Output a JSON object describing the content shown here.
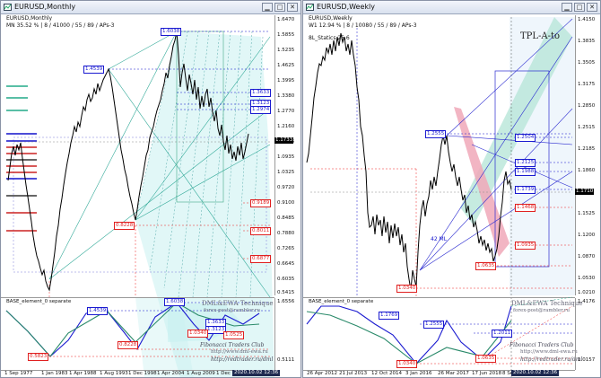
{
  "left": {
    "title": "EURUSD,Monthly",
    "info_line": "MN  35.52 %  | 8 / 41000 / 55 / 89 / APs-3",
    "sub_info": "EURUSD,Monthly",
    "subwindow_label": "BASE_element_0 separate",
    "current_price": "1.1733",
    "price_scale": [
      "1.6470",
      "1.5855",
      "1.5235",
      "1.4625",
      "1.3995",
      "1.3380",
      "1.2770",
      "1.2160",
      "1.1545",
      "1.0935",
      "1.0325",
      "0.9720",
      "0.9100",
      "0.8485",
      "0.7880",
      "0.7265",
      "0.6645",
      "0.6035",
      "0.5415"
    ],
    "sub_scale": [
      "1.6556",
      "0.5111"
    ],
    "time_scale": [
      "1 Sep 1977",
      "1 Jan 1983",
      "1 Apr 1988",
      "1 Aug 1993",
      "1 Dec 1998",
      "1 Apr 2004",
      "1 Aug 2009",
      "1 Dec"
    ],
    "time_badge": "2020.10.02 12:36",
    "levels": {
      "l1": "1.6038",
      "l2": "1.4539",
      "l3": "1.3633",
      "l4": "1.3123",
      "l5": "1.2974",
      "l6": "0.9189",
      "l7": "0.8228",
      "l8": "0.8011",
      "l9": "0.6877"
    },
    "sub_levels": {
      "s1": "1.6038",
      "s2": "1.4539",
      "s3": "0.8228",
      "s4": "1.3633",
      "s5": "1.3123",
      "s6": "1.0340",
      "s7": "1.0525",
      "s8": "0.5823"
    },
    "watermark": {
      "l1": "DML&EWA Technique",
      "l2": "forex-post@rambler.ru",
      "l3": "Fibonacci Traders Club",
      "l4": "http://www.dml-ewa.ru",
      "l5": "http://redtrader.ru/dml"
    }
  },
  "right": {
    "title": "EURUSD,Weekly",
    "info_line": "W1  12.94 %  | 8 / 10080 / 55 / 89 / APs-3",
    "sub_info": "EURUSD,Weekly",
    "indicator_label": "8L_Statics 25.6",
    "tpl_label": "TPL-A-to",
    "ml_label": "42 ML",
    "current_price": "1.1710",
    "price_scale": [
      "1.4150",
      "1.3835",
      "1.3505",
      "1.3175",
      "1.2850",
      "1.2515",
      "1.2185",
      "1.1860",
      "1.1525",
      "1.1200",
      "1.0870",
      "1.0530",
      "1.0210"
    ],
    "sub_scale": [
      "1.4176",
      "1.0157"
    ],
    "time_scale": [
      "26 Apr 2012",
      "21 Jul 2013",
      "12 Oct 2014",
      "3 Jan 2016",
      "26 Mar 2017",
      "17 Jun 2018",
      "8 Se"
    ],
    "time_badge": "2020.10.02 12:36",
    "subwindow_label": "BASE_element_0 separate",
    "levels": {
      "l1": "1.2555",
      "l2": "1.2504",
      "l3": "1.2125",
      "l4": "1.1988",
      "l5": "1.1739",
      "l6": "1.1468",
      "l7": "1.0935",
      "l8": "1.0635",
      "l9": "1.0340"
    },
    "sub_levels": {
      "s1": "1.2555",
      "s2": "1.2011",
      "s3": "1.0635",
      "s4": "1.0340",
      "s5": "1.1769"
    },
    "watermark": {
      "l1": "DML&EWA Technique",
      "l2": "forex-post@rambler.ru",
      "l3": "Fibonacci Traders Club",
      "l4": "http://www.dml-ewa.ru",
      "l5": "http://redtrader.ru/dml"
    }
  },
  "colors": {
    "title_bg": "#dfe6f2",
    "blue_level": "#1a1ad0",
    "red_level": "#e02020",
    "cyan_fill": "#c8f0f0",
    "green_fill": "#b8e6d8",
    "pink_fill": "#f0a8b8"
  }
}
